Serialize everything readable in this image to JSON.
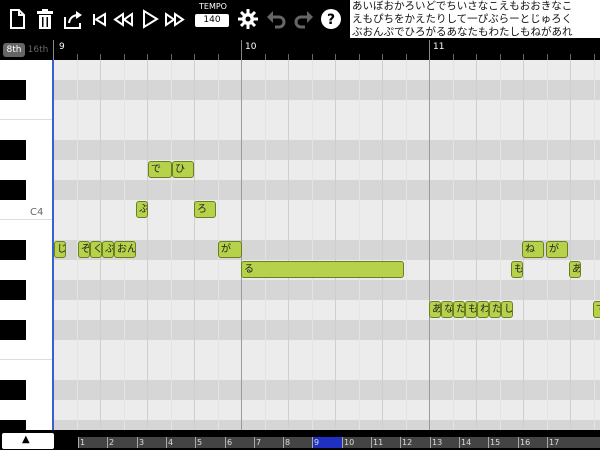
{
  "toolbar": {
    "icons": [
      "new-file-icon",
      "trash-icon",
      "share-icon",
      "skip-to-start-icon",
      "rewind-icon",
      "play-icon",
      "fast-forward-icon",
      "gear-icon",
      "undo-icon",
      "redo-icon",
      "help-icon"
    ],
    "tempo_label": "TEMPO",
    "tempo_value": "140",
    "lyrics_line1": "あいぼおかろいどでちいさなこえもおおきなこ",
    "lyrics_line2": "えもぴちをかえたりして一ぴぶらーとじゅろく",
    "lyrics_line3": "ぶおんぷでひろがるあなたもわたしもねがあれ"
  },
  "ruler": {
    "snap_8": "8th",
    "snap_16": "16th",
    "bars": [
      "9",
      "10",
      "11"
    ]
  },
  "keyboard": {
    "c4_label": "C4"
  },
  "notes": [
    {
      "text": "じゅ",
      "row": 9
    },
    {
      "text": "ぞ",
      "row": 9
    },
    {
      "text": "く",
      "row": 9
    },
    {
      "text": "ぶ",
      "row": 9
    },
    {
      "text": "おん",
      "row": 9
    },
    {
      "text": "ぷ",
      "row": 7
    },
    {
      "text": "で",
      "row": 5
    },
    {
      "text": "ひ",
      "row": 5
    },
    {
      "text": "ろ",
      "row": 7
    },
    {
      "text": "が",
      "row": 9
    },
    {
      "text": "る",
      "row": 10
    },
    {
      "text": "あ",
      "row": 12
    },
    {
      "text": "な",
      "row": 12
    },
    {
      "text": "た",
      "row": 12
    },
    {
      "text": "も",
      "row": 12
    },
    {
      "text": "わ",
      "row": 12
    },
    {
      "text": "た",
      "row": 12
    },
    {
      "text": "し",
      "row": 12
    },
    {
      "text": "も",
      "row": 10
    },
    {
      "text": "ね",
      "row": 9
    },
    {
      "text": "が",
      "row": 9
    },
    {
      "text": "あ",
      "row": 10
    },
    {
      "text": "で",
      "row": 12
    }
  ],
  "bottom": {
    "up_label": "▲",
    "overview": [
      "1",
      "2",
      "3",
      "4",
      "5",
      "6",
      "7",
      "8",
      "9",
      "10",
      "11",
      "12",
      "13",
      "14",
      "15",
      "16",
      "17"
    ],
    "current_bar": "9"
  }
}
